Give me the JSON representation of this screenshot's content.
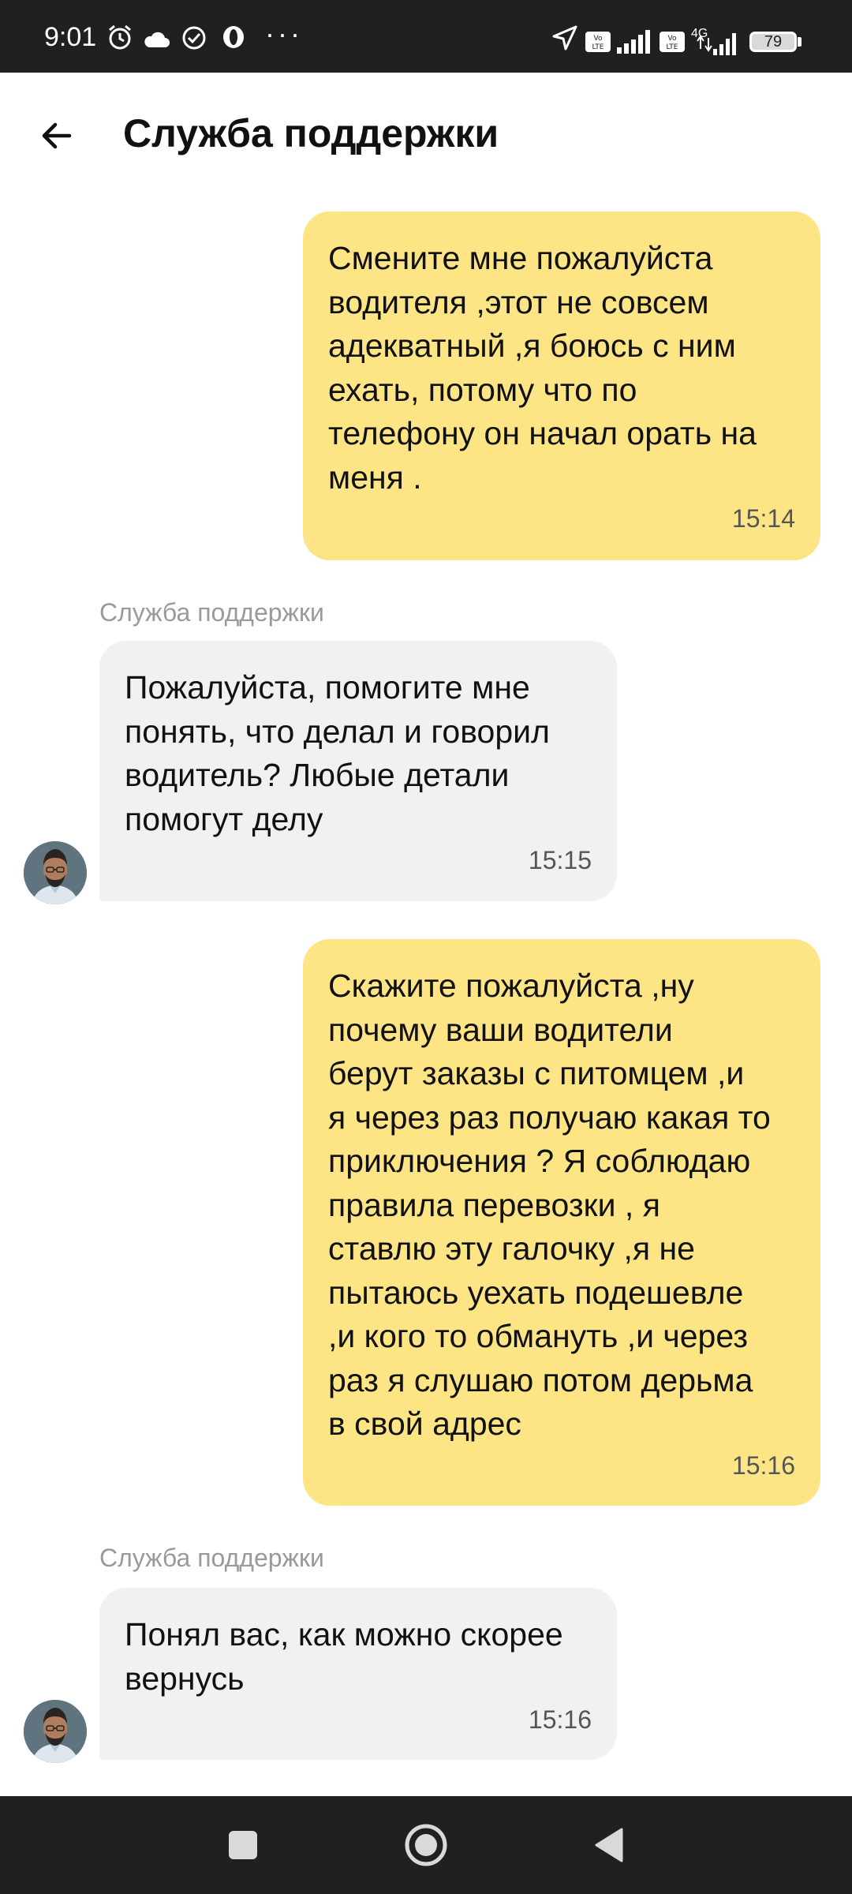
{
  "status_bar": {
    "time": "9:01",
    "battery": "79",
    "network": "4G",
    "icons": [
      "alarm-icon",
      "cloud-icon",
      "check-circle-icon",
      "opera-icon",
      "more-icon",
      "location-arrow-icon",
      "volte-icon",
      "signal-icon",
      "battery-icon"
    ]
  },
  "header": {
    "title": "Служба поддержки",
    "back_icon": "back-arrow-icon"
  },
  "chat": {
    "sender_name": "Служба поддержки",
    "messages": [
      {
        "direction": "outgoing",
        "lines": [
          "Смените мне пожалуйста",
          "водителя ,этот не совсем",
          "адекватный ,я боюсь с ним",
          "ехать, потому что по",
          "телефону он начал орать на",
          "меня ."
        ],
        "time": "15:14"
      },
      {
        "direction": "incoming",
        "sender": "Служба поддержки",
        "lines": [
          "Пожалуйста, помогите мне",
          "понять, что делал и говорил",
          "водитель? Любые детали",
          "помогут делу"
        ],
        "time": "15:15"
      },
      {
        "direction": "outgoing",
        "lines": [
          "Скажите пожалуйста ,ну",
          "почему ваши водители",
          "берут заказы с питомцем ,и",
          "я через раз получаю какая то",
          "приключения ? Я соблюдаю",
          "правила перевозки , я",
          "ставлю эту галочку ,я не",
          "пытаюсь уехать подешевле",
          ",и кого то обмануть ,и через",
          "раз я слушаю потом дерьма",
          "в свой адрес"
        ],
        "time": "15:16"
      },
      {
        "direction": "incoming",
        "sender": "Служба поддержки",
        "lines": [
          "Понял вас, как можно скорее",
          "вернусь"
        ],
        "time": "15:16"
      }
    ]
  },
  "colors": {
    "outgoing_bubble": "#fde586",
    "incoming_bubble": "#f2f1ef",
    "system_bars": "#202020",
    "sender_label": "#9a9a9a"
  },
  "navigation_bar": {
    "buttons": [
      "recents-square-icon",
      "home-circle-icon",
      "back-triangle-icon"
    ]
  }
}
